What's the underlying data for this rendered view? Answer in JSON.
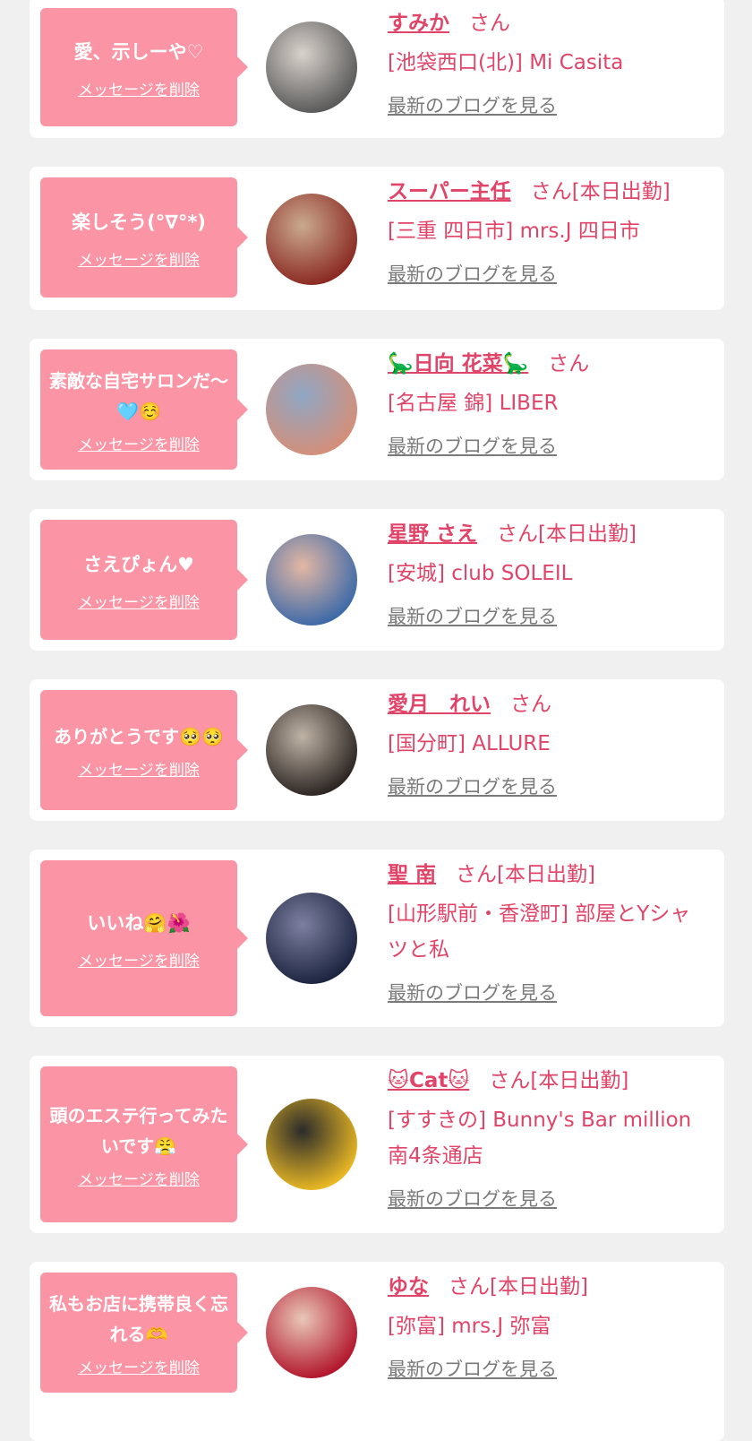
{
  "delete_label": "メッセージを削除",
  "blog_label": "最新のブログを見る",
  "colors": {
    "accent": "#e04468",
    "bubble": "#fb94a4",
    "background": "#f0f0f0"
  },
  "entries": [
    {
      "message": "愛、示しーや♡",
      "name": "すみか",
      "status": "さん",
      "shop": "[池袋西口(北)] Mi Casita",
      "avatar_colors": [
        "#5a5a5a",
        "#d9d2cc"
      ]
    },
    {
      "message": "楽しそう(°∇°*)",
      "name": "スーパー主任",
      "status": "さん[本日出勤]",
      "shop": "[三重 四日市] mrs.J 四日市",
      "avatar_colors": [
        "#8b2a22",
        "#caa98f"
      ]
    },
    {
      "message": "素敵な自宅サロンだ〜🩵☺️",
      "name": "🦕日向 花菜🦕",
      "status": "さん",
      "shop": "[名古屋 錦] LIBER",
      "avatar_colors": [
        "#d48f7a",
        "#8fa7c5"
      ]
    },
    {
      "message": "さえぴょん♥",
      "name": "星野 さえ",
      "status": "さん[本日出勤]",
      "shop": "[安城] club SOLEIL",
      "avatar_colors": [
        "#3e6aa8",
        "#e3b7a4"
      ]
    },
    {
      "message": "ありがとうです🥺🥺",
      "name": "愛月　れい",
      "status": "さん",
      "shop": "[国分町] ALLURE",
      "avatar_colors": [
        "#2c2522",
        "#bfb3a6"
      ]
    },
    {
      "message": "いいね🤗🌺",
      "name": "聖 南",
      "status": "さん[本日出勤]",
      "shop": "[山形駅前・香澄町] 部屋とYシャツと私",
      "avatar_colors": [
        "#1c2440",
        "#7d7fa0"
      ]
    },
    {
      "message": "頭のエステ行ってみたいです😤",
      "name": "🐱Cat🐱",
      "status": "さん[本日出勤]",
      "shop": "[すすきの] Bunny's Bar million 南4条通店",
      "avatar_colors": [
        "#e9b824",
        "#2b2b2b"
      ]
    },
    {
      "message": "私もお店に携帯良く忘れる🫶",
      "name": "ゆな",
      "status": "さん[本日出勤]",
      "shop": "[弥富] mrs.J 弥富",
      "avatar_colors": [
        "#b2162c",
        "#e9c7b8"
      ]
    }
  ]
}
